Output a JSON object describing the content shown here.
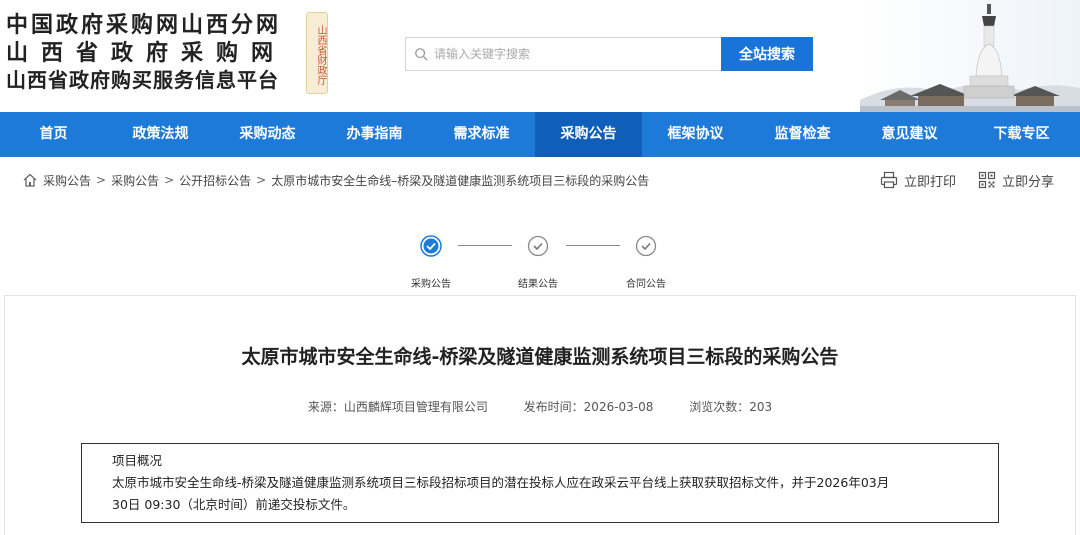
{
  "header": {
    "logo_line1": "中国政府采购网山西分网",
    "logo_line2": "山西省政府采购网",
    "logo_line3": "山西省政府购买服务信息平台",
    "seal_text": "山西省财政厅",
    "search_placeholder": "请输入关键字搜索",
    "search_button": "全站搜索"
  },
  "nav": {
    "items": [
      {
        "label": "首页"
      },
      {
        "label": "政策法规"
      },
      {
        "label": "采购动态"
      },
      {
        "label": "办事指南"
      },
      {
        "label": "需求标准"
      },
      {
        "label": "采购公告"
      },
      {
        "label": "框架协议"
      },
      {
        "label": "监督检查"
      },
      {
        "label": "意见建议"
      },
      {
        "label": "下载专区"
      }
    ],
    "active": "采购公告"
  },
  "breadcrumb": {
    "items": [
      "采购公告",
      "采购公告",
      "公开招标公告",
      "太原市城市安全生命线–桥梁及隧道健康监测系统项目三标段的采购公告"
    ],
    "separator": ">"
  },
  "tools": {
    "print": "立即打印",
    "share": "立即分享"
  },
  "steps": [
    {
      "label": "采购公告",
      "active": true
    },
    {
      "label": "结果公告",
      "active": false
    },
    {
      "label": "合同公告",
      "active": false
    }
  ],
  "article": {
    "title": "太原市城市安全生命线-桥梁及隧道健康监测系统项目三标段的采购公告",
    "source": "来源：山西麟辉项目管理有限公司",
    "publish_time": "发布时间：2026-03-08",
    "views": "浏览次数：203",
    "summary_title": "项目概况",
    "summary_line1": "太原市城市安全生命线-桥梁及隧道健康监测系统项目三标段招标项目的潜在投标人应在政采云平台线上获取获取招标文件，并于2026年03月",
    "summary_line2": "30日 09:30（北京时间）前递交投标文件。"
  },
  "colors": {
    "nav_bg": "#1e7ad9",
    "nav_active": "#0f5fb8",
    "accent": "#1a73d8"
  }
}
